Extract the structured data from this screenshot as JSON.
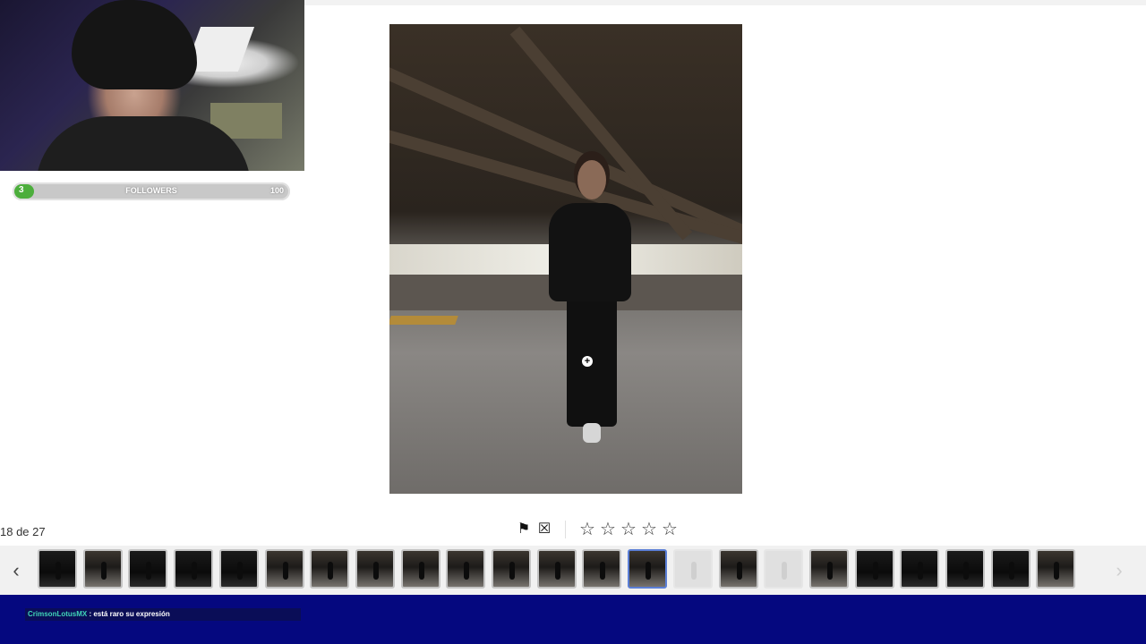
{
  "webcam": {
    "label": "webcam-feed"
  },
  "followers_goal": {
    "label": "FOLLOWERS",
    "current": "3",
    "target": "100",
    "progress_fraction": 0.03,
    "fill_color": "#4cae3c"
  },
  "viewer": {
    "counter": "18 de 27",
    "pick_flag_icon": "flag-check-icon",
    "reject_flag_icon": "flag-x-icon",
    "rating": {
      "max": 5,
      "value": 0
    }
  },
  "filmstrip": {
    "prev_icon": "chevron-left-icon",
    "next_icon": "chevron-right-icon",
    "total": 23,
    "active_index": 13
  },
  "chat": {
    "username": "CrimsonLotusMX",
    "message": " : está raro su expresión",
    "username_color": "#40d6b8",
    "bar_color": "#05087f"
  }
}
